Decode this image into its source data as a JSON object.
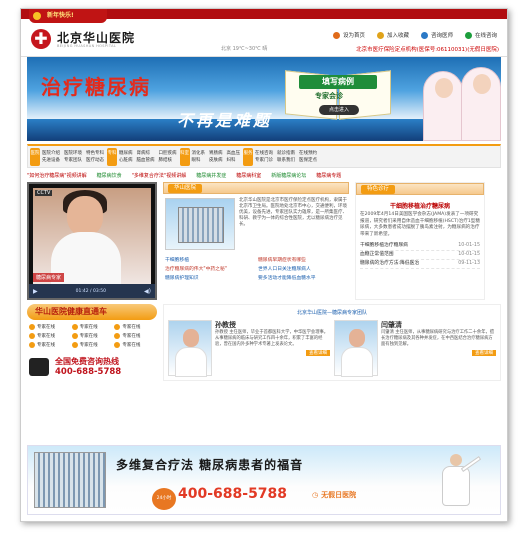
{
  "newyear": "新年快乐!",
  "header": {
    "logo_cn": "北京华山医院",
    "logo_en": "BEIJING HUASHAN HOSPITAL",
    "weather": "北京 19℃~30℃ 晴",
    "links": [
      {
        "label": "设为首页",
        "color": "#e06b1a"
      },
      {
        "label": "加入收藏",
        "color": "#e0a31a"
      },
      {
        "label": "咨询医师",
        "color": "#2b79c6"
      },
      {
        "label": "在线咨询",
        "color": "#1c9e3c"
      }
    ],
    "hotline": "北京市医疗保险定点机构(医保号:06110031)(无假日医院)"
  },
  "banner": {
    "title1": "治疗糖尿病",
    "title2": "不再是难题",
    "fill_case": "填写病例",
    "expert": "专家会诊",
    "click": "点击进入"
  },
  "nav": [
    {
      "tag": "医院",
      "items": [
        "医院介绍",
        "医院环境",
        "特色专科",
        "先进设备",
        "专家团队",
        "医疗动态"
      ]
    },
    {
      "tag": "专科",
      "items": [
        "糖尿病",
        "肾病综",
        "口腔疾病",
        "心脏病",
        "脑血管病",
        "肺结核"
      ]
    },
    {
      "tag": "科室",
      "items": [
        "消化系",
        "胃肠病",
        "高血压",
        "眼科",
        "皮肤病",
        "妇科"
      ]
    },
    {
      "tag": "服务",
      "items": [
        "在线咨询",
        "就诊指南",
        "在线预约",
        "专家门诊",
        "联系我们",
        "医保定点"
      ]
    }
  ],
  "ticker": [
    "\"如何治疗糖尿病\"视频讲解",
    "糖尿病饮食",
    "\"多维复合疗法\"视频讲解",
    "糖尿病并发症",
    "糖尿病科室",
    "新版糖尿病论坛",
    "糖尿病专题",
    "就诊指南"
  ],
  "video": {
    "channel": "CCTV",
    "caption": "糖尿病专家",
    "time": "01:42 / 03:50"
  },
  "huashan": {
    "title": "华山医院",
    "desc": "北京华山医院是北京市医疗保险定点医疗机构，隶属于北京市卫生局。医院地处北京市中心，交通便利，环境优美，设备先进，专家团队实力雄厚，是一所集医疗、科研、教学为一体的综合性医院，尤以糖尿病治疗见长。",
    "links": [
      {
        "text": "干细胞移植",
        "red": false
      },
      {
        "text": "糖尿病早期症状有哪些",
        "red": true
      },
      {
        "text": "治疗糖尿病的伟大\"中药之秘\"",
        "red": true
      },
      {
        "text": "世界人口日关注糖尿病人",
        "red": false
      },
      {
        "text": "糖尿病护理知识",
        "red": false
      },
      {
        "text": "要多活动才能降低血糖水平",
        "red": false
      }
    ]
  },
  "special": {
    "title": "特色诊疗",
    "headline": "干细胞移植治疗糖尿病",
    "text": "在2009年4月14日美国医学会杂志(JAMA)发表了一项研究报道，研究者们采用自体造血干细胞移植(HSCT)治疗1型糖尿病，大多数患者成功摆脱了胰岛素注射，为糖尿病的治疗带来了新希望。",
    "items": [
      {
        "t": "干细胞移植治疗糖尿病",
        "d": "10-01-15"
      },
      {
        "t": "血糖正常值范围",
        "d": "10-01-15"
      },
      {
        "t": "糖尿病的治疗方法:降低医治",
        "d": "09-11-13"
      }
    ]
  },
  "express": {
    "title": "华山医院健康直通车",
    "qq": [
      "专家在线",
      "专家在线",
      "专家在线",
      "专家在线",
      "专家在线",
      "专家在线",
      "专家在线",
      "专家在线",
      "专家在线"
    ],
    "free": "全国免费咨询热线",
    "number": "400-688-5788"
  },
  "experts": {
    "header": "北京华山医院—糖尿病专家团队",
    "list": [
      {
        "name": "孙教授",
        "bio": "孙教授 主任医师，毕业于首都医科大学，中华医学会理事。从事糖尿病的临床与研究工作四十余年，积累了丰富的经验，曾在国内外多种学术专著上发表论文。"
      },
      {
        "name": "闫肇清",
        "bio": "闫肇清 主任医师，从事糖尿病研究与治疗工作二十余年，擅长治疗糖尿病及其各种并发症，在中西医结合治疗糖尿病方面有独到见解。"
      }
    ],
    "more": "查看详细"
  },
  "footer": {
    "slogan": "多维复合疗法 糖尿病患者的福音",
    "badge": "24小时",
    "phone": "400-688-5788",
    "noholiday": "无假日医院"
  }
}
